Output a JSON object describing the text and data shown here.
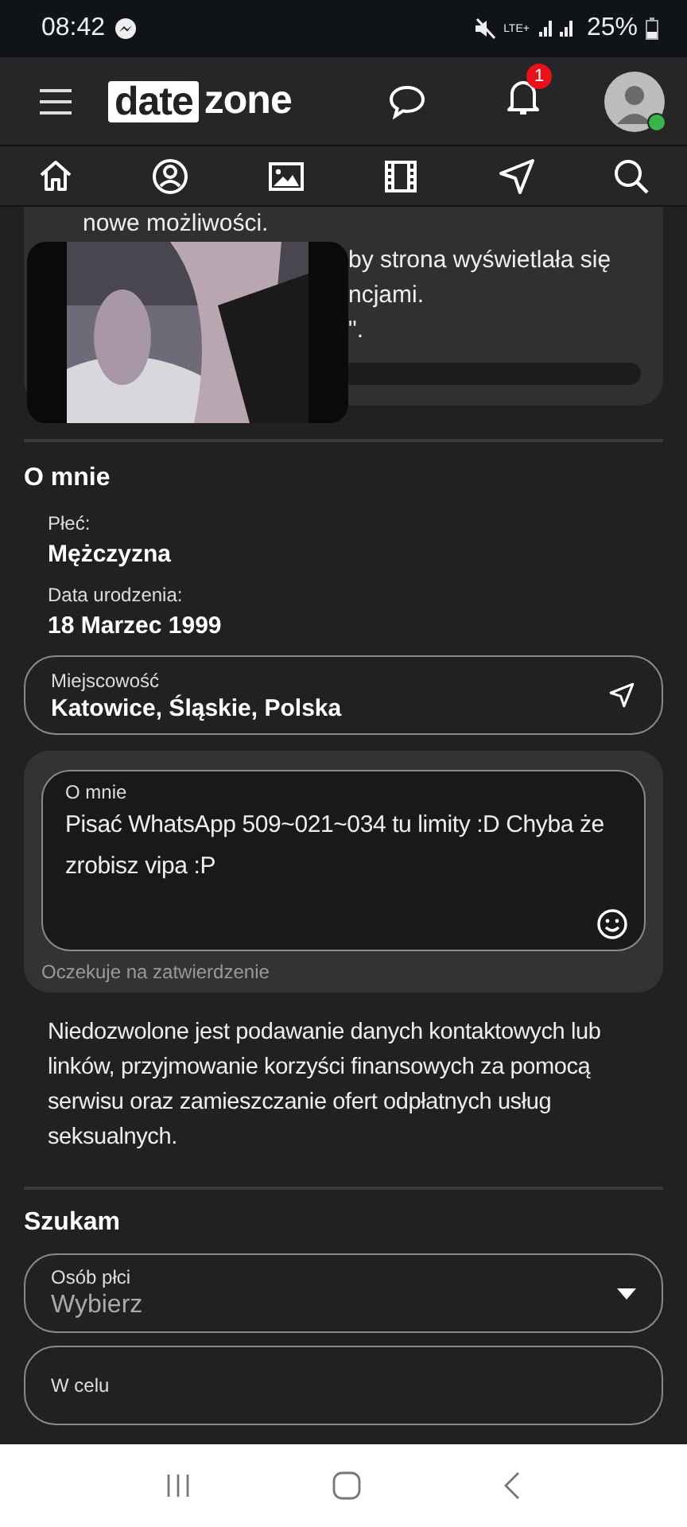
{
  "status_bar": {
    "time": "08:42",
    "network": "LTE+",
    "battery": "25%"
  },
  "header": {
    "logo_left": "date",
    "logo_right": "zone",
    "notification_count": "1"
  },
  "nav_tabs": [
    {
      "kind": "home"
    },
    {
      "kind": "profile"
    },
    {
      "kind": "photos"
    },
    {
      "kind": "videos"
    },
    {
      "kind": "location"
    },
    {
      "kind": "search"
    }
  ],
  "notice": {
    "lines": [
      "nowe możliwości.",
      "by strona wyświetlała się",
      "ncjami.",
      "\"."
    ]
  },
  "about_section": {
    "title": "O mnie",
    "facts": [
      {
        "label": "Płeć:",
        "value": "Mężczyzna"
      },
      {
        "label": "Data urodzenia:",
        "value": "18 Marzec 1999"
      }
    ],
    "location_field": {
      "label": "Miejscowość",
      "value": "Katowice, Śląskie, Polska"
    },
    "about_field": {
      "label": "O mnie",
      "value": "Pisać WhatsApp 509~021~034 tu limity :D Chyba że zrobisz vipa :P",
      "helper": "Oczekuje na zatwierdzenie"
    },
    "rules_note": "Niedozwolone jest podawanie danych kontaktowych lub linków, przyjmowanie korzyści finansowych za pomocą serwisu oraz zamieszczanie ofert odpłatnych usług seksualnych."
  },
  "search_section": {
    "title": "Szukam",
    "fields": [
      {
        "label": "Osób płci",
        "placeholder": "Wybierz"
      },
      {
        "label": "W celu"
      }
    ]
  }
}
